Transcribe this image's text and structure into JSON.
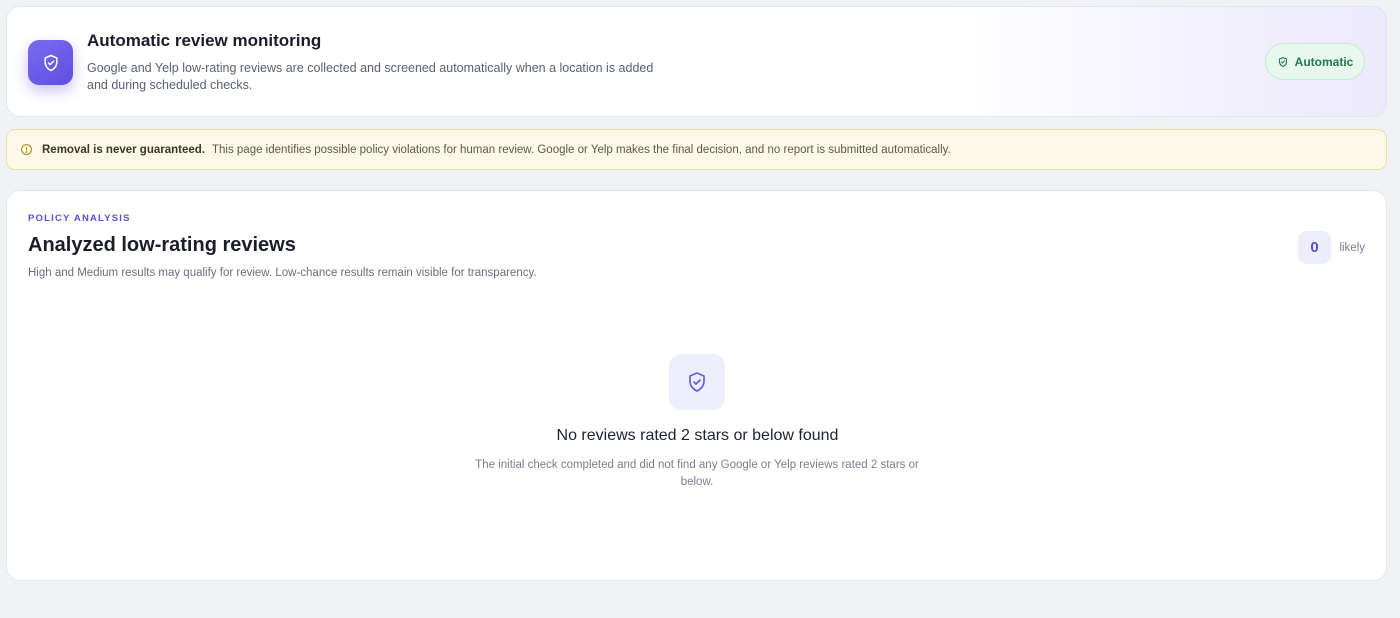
{
  "monitor": {
    "title": "Automatic review monitoring",
    "description": "Google and Yelp low-rating reviews are collected and screened automatically when a location is added and during scheduled checks.",
    "badge_label": "Automatic",
    "icon": "shield-check-icon"
  },
  "warning": {
    "strong": "Removal is never guaranteed.",
    "text": "This page identifies possible policy violations for human review. Google or Yelp makes the final decision, and no report is submitted automatically.",
    "icon": "info-circle-icon"
  },
  "analysis": {
    "eyebrow": "POLICY ANALYSIS",
    "title": "Analyzed low-rating reviews",
    "description": "High and Medium results may qualify for review. Low-chance results remain visible for transparency.",
    "count": "0",
    "count_label": "likely",
    "empty": {
      "icon": "shield-check-icon",
      "title": "No reviews rated 2 stars or below found",
      "description": "The initial check completed and did not find any Google or Yelp reviews rated 2 stars or below."
    }
  },
  "colors": {
    "accent": "#5b4fd6",
    "success": "#22794a",
    "warning_bg": "#fdf8e7"
  }
}
